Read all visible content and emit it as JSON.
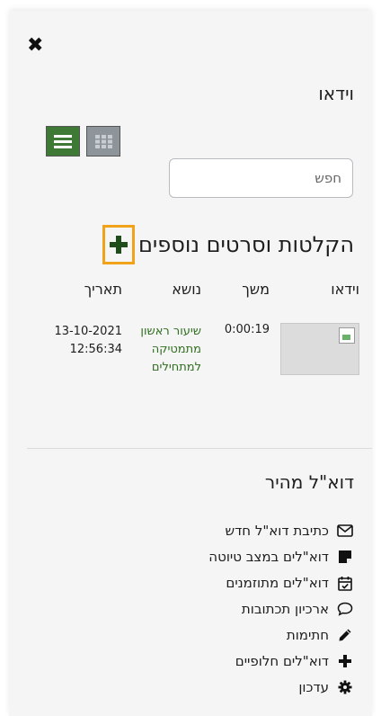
{
  "close_label": "✖",
  "video_section": {
    "title": "וידאו"
  },
  "view_toggle": {
    "list_icon": "list-view-icon",
    "grid_icon": "grid-view-icon"
  },
  "search": {
    "placeholder": "חפש",
    "value": ""
  },
  "recordings": {
    "heading": "הקלטות וסרטים נוספים",
    "add_icon": "plus-icon",
    "columns": [
      "וידאו",
      "משך",
      "נושא",
      "תאריך"
    ],
    "rows": [
      {
        "thumbnail_icon": "broken-image-icon",
        "duration": "0:00:19",
        "topic_lines": [
          "שיעור ראשון",
          "מתמטיקה",
          "למתחילים"
        ],
        "date_lines": [
          "13-10-2021",
          "12:56:34"
        ]
      }
    ]
  },
  "quick_mail": {
    "title": "דוא\"ל מהיר",
    "items": [
      {
        "label": "כתיבת דוא\"ל חדש",
        "icon": "envelope-icon"
      },
      {
        "label": "דוא\"לים במצב טיוטה",
        "icon": "note-icon"
      },
      {
        "label": "דוא\"לים מתוזמנים",
        "icon": "calendar-check-icon"
      },
      {
        "label": "ארכיון תכתובות",
        "icon": "speech-bubble-icon"
      },
      {
        "label": "חתימות",
        "icon": "pencil-icon"
      },
      {
        "label": "דוא\"לים חלופיים",
        "icon": "plus-icon"
      },
      {
        "label": "עדכון",
        "icon": "gear-icon"
      }
    ]
  },
  "colors": {
    "accent_green": "#3e7a36",
    "link_green": "#2f6e1f",
    "focus_orange": "#f0a21b"
  }
}
